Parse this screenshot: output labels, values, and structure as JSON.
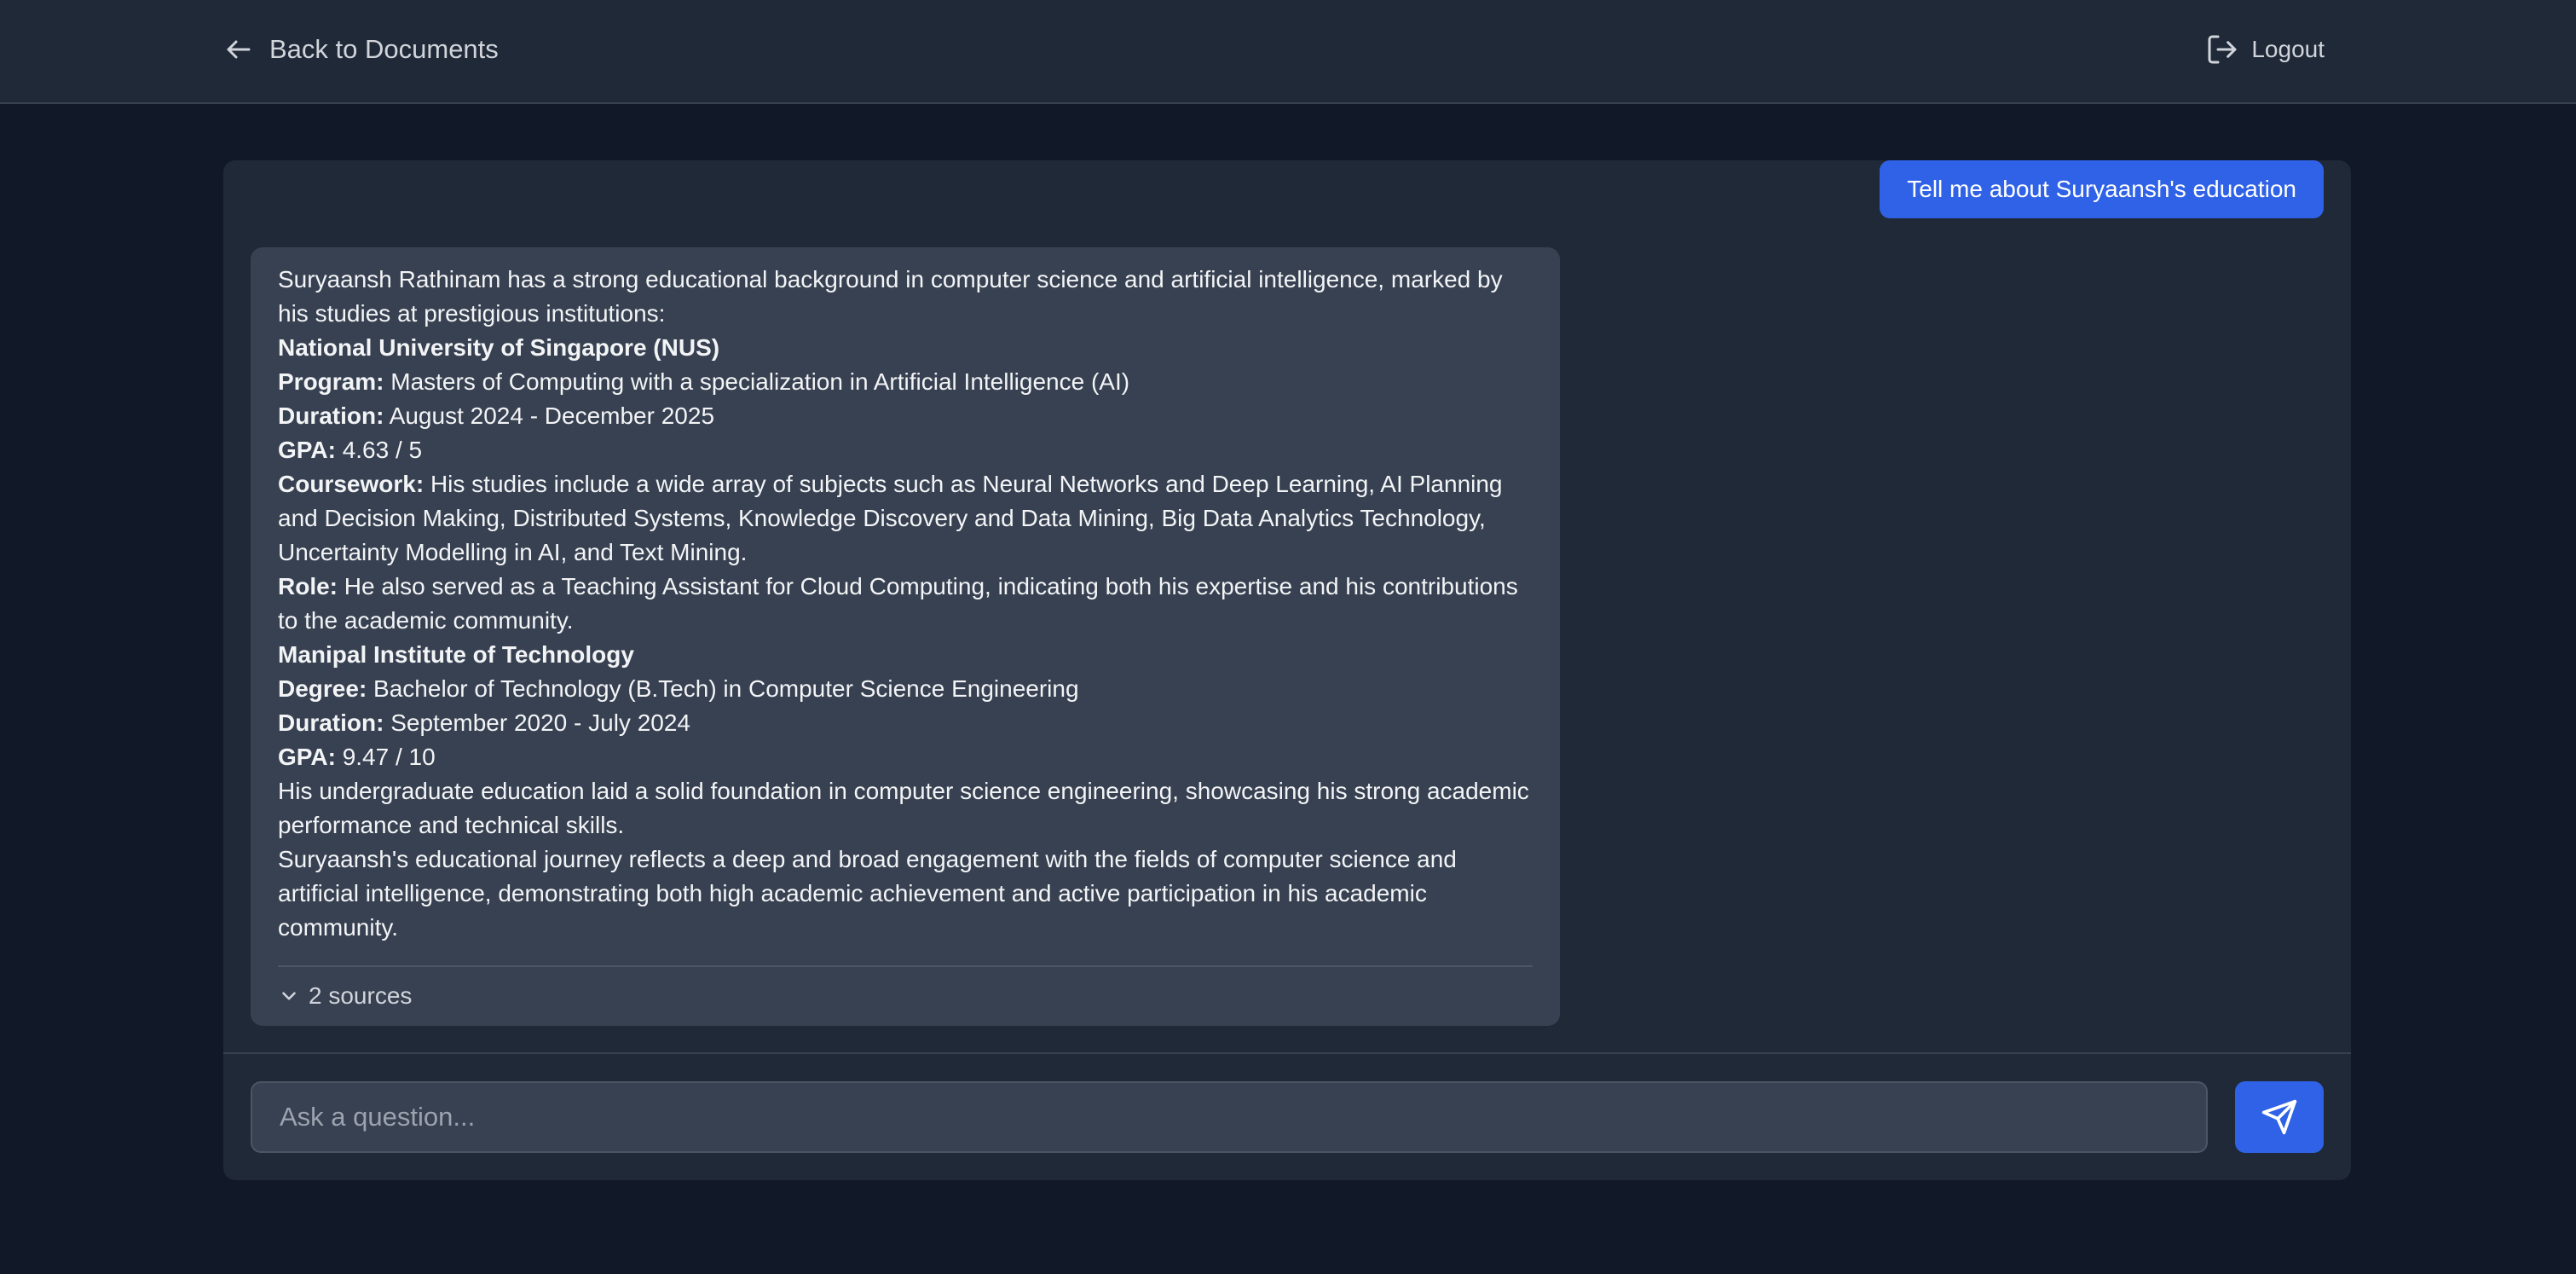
{
  "header": {
    "back_label": "Back to Documents",
    "logout_label": "Logout"
  },
  "chat": {
    "user_message": "Tell me about Suryaansh's education",
    "assistant": {
      "intro": "Suryaansh Rathinam has a strong educational background in computer science and artificial intelligence, marked by his studies at prestigious institutions:",
      "nus": {
        "name": "National University of Singapore (NUS)",
        "program_label": "Program:",
        "program": "Masters of Computing with a specialization in Artificial Intelligence (AI)",
        "duration_label": "Duration:",
        "duration": "August 2024 - December 2025",
        "gpa_label": "GPA:",
        "gpa": "4.63 / 5",
        "coursework_label": "Coursework:",
        "coursework": "His studies include a wide array of subjects such as Neural Networks and Deep Learning, AI Planning and Decision Making, Distributed Systems, Knowledge Discovery and Data Mining, Big Data Analytics Technology, Uncertainty Modelling in AI, and Text Mining.",
        "role_label": "Role:",
        "role": "He also served as a Teaching Assistant for Cloud Computing, indicating both his expertise and his contributions to the academic community."
      },
      "mit": {
        "name": "Manipal Institute of Technology",
        "degree_label": "Degree:",
        "degree": "Bachelor of Technology (B.Tech) in Computer Science Engineering",
        "duration_label": "Duration:",
        "duration": "September 2020 - July 2024",
        "gpa_label": "GPA:",
        "gpa": "9.47 / 10"
      },
      "undergrad_note": "His undergraduate education laid a solid foundation in computer science engineering, showcasing his strong academic performance and technical skills.",
      "conclusion": "Suryaansh's educational journey reflects a deep and broad engagement with the fields of computer science and artificial intelligence, demonstrating both high academic achievement and active participation in his academic community.",
      "sources_label": "2 sources"
    }
  },
  "composer": {
    "placeholder": "Ask a question...",
    "value": ""
  },
  "icons": {
    "back": "arrow-left-icon",
    "logout": "logout-icon",
    "sources": "chevron-down-icon",
    "send": "send-icon"
  },
  "colors": {
    "background": "#111827",
    "panel": "#1f2937",
    "bubble": "#374151",
    "accent": "#2f62e6"
  }
}
